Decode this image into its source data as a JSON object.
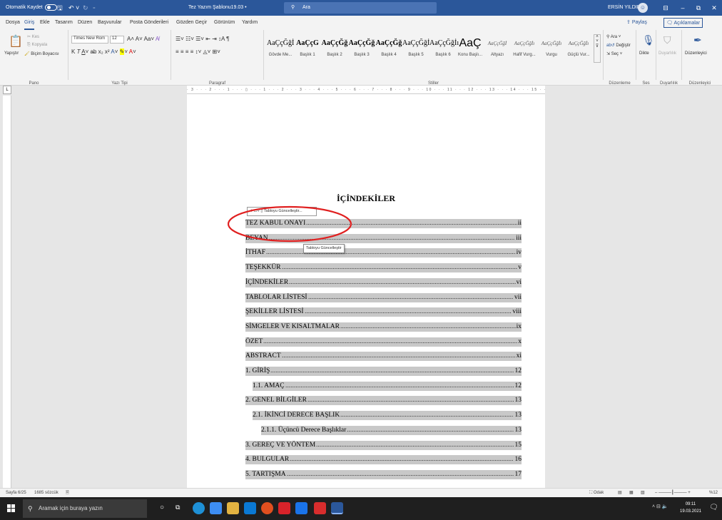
{
  "titlebar": {
    "autosave_label": "Otomatik Kaydet",
    "doc_title": "Tez Yazım Şablonu19.03 •",
    "search_placeholder": "Ara",
    "user_name": "ERSİN YILDIRIM"
  },
  "menu_tabs": [
    "Dosya",
    "Giriş",
    "Ekle",
    "Tasarım",
    "Düzen",
    "Başvurular",
    "Posta Gönderileri",
    "Gözden Geçir",
    "Görünüm",
    "Yardım"
  ],
  "share": {
    "share_label": "Paylaş",
    "comments_label": "Açıklamalar"
  },
  "ribbon": {
    "clipboard": {
      "paste": "Yapıştır",
      "cut": "Kes",
      "copy": "Kopyala",
      "format_painter": "Biçim Boyacısı",
      "group_label": "Pano"
    },
    "font": {
      "font_name": "Times New Rom",
      "font_size": "12",
      "group_label": "Yazı Tipi"
    },
    "paragraph": {
      "group_label": "Paragraf"
    },
    "styles": {
      "group_label": "Stiller",
      "items": [
        {
          "preview": "AaÇçĞğİ",
          "name": "Gövde Me..."
        },
        {
          "preview": "AaÇçG",
          "name": "Başlık 1"
        },
        {
          "preview": "AaÇçĞğ",
          "name": "Başlık 2"
        },
        {
          "preview": "AaÇçĞğ",
          "name": "Başlık 3"
        },
        {
          "preview": "AaÇçĞğ",
          "name": "Başlık 4"
        },
        {
          "preview": "AaÇçĞğİ",
          "name": "Başlık 5"
        },
        {
          "preview": "AaÇçĞğİı",
          "name": "Başlık 6"
        },
        {
          "preview": "AaÇ",
          "name": "Konu Başlı..."
        },
        {
          "preview": "AaÇçĞğİ",
          "name": "Altyazı"
        },
        {
          "preview": "AaÇçĞğİı",
          "name": "Hafif Vurg..."
        },
        {
          "preview": "AaÇçĞğİı",
          "name": "Vurgu"
        },
        {
          "preview": "AaÇçĞğİı",
          "name": "Güçlü Vur..."
        }
      ]
    },
    "editing": {
      "find": "Ara",
      "replace": "Değiştir",
      "select": "Seç",
      "group_label": "Düzenleme"
    },
    "voice": {
      "dictate": "Dikte",
      "group_label": "Ses"
    },
    "sensitivity": {
      "label": "Duyarlılık",
      "group_label": "Duyarlılık"
    },
    "editor": {
      "label": "Düzenleyici",
      "group_label": "Düzenleyici"
    }
  },
  "ruler_text": "· 3 · · · 2 · · · 1 · · · ▯ · · · 1 · · · 2 · · · 3 · · · 4 · · · 5 · · · 6 · · · 7 · · · 8 · · · 9 · · · 10 · · · 11 · · · 12 · · · 13 · · · 14 · · · 15 · · · ▯16 · · · 17 · · ·",
  "document": {
    "heading": "İÇİNDEKİLER",
    "toc_control_label": "Tabloyu Güncelleştir...",
    "tooltip": "Tabloyu Güncelleştir",
    "toc": [
      {
        "title": "TEZ KABUL ONAYI",
        "page": "ii",
        "level": 1
      },
      {
        "title": "BEYAN",
        "page": "iii",
        "level": 1
      },
      {
        "title": "İTHAF",
        "page": "iv",
        "level": 1
      },
      {
        "title": "TEŞEKKÜR",
        "page": "v",
        "level": 1
      },
      {
        "title": "İÇİNDEKİLER",
        "page": "vi",
        "level": 1
      },
      {
        "title": "TABLOLAR LİSTESİ",
        "page": "vii",
        "level": 1
      },
      {
        "title": "ŞEKİLLER LİSTESİ",
        "page": "viii",
        "level": 1
      },
      {
        "title": "SİMGELER VE KISALTMALAR",
        "page": "ix",
        "level": 1
      },
      {
        "title": "ÖZET",
        "page": "x",
        "level": 1
      },
      {
        "title": "ABSTRACT",
        "page": "xi",
        "level": 1
      },
      {
        "title": "1. GİRİŞ",
        "page": "12",
        "level": 1
      },
      {
        "title": "1.1. AMAÇ",
        "page": "12",
        "level": 2
      },
      {
        "title": "2. GENEL BİLGİLER",
        "page": "13",
        "level": 1
      },
      {
        "title": "2.1. İKİNCİ DERECE BAŞLIK",
        "page": "13",
        "level": 2
      },
      {
        "title": "2.1.1. Üçüncü Derece Başlıklar",
        "page": "13",
        "level": 3
      },
      {
        "title": "3. GEREÇ VE YÖNTEM",
        "page": "15",
        "level": 1
      },
      {
        "title": "4. BULGULAR",
        "page": "16",
        "level": 1
      },
      {
        "title": "5. TARTIŞMA",
        "page": "17",
        "level": 1
      }
    ]
  },
  "statusbar": {
    "page": "Sayfa 6/25",
    "words": "1685 sözcük",
    "focus": "Odak",
    "zoom": "%12"
  },
  "taskbar": {
    "search_placeholder": "Aramak için buraya yazın",
    "time": "09:11",
    "date": "19.03.2021"
  },
  "colors": {
    "word_blue": "#2b579a",
    "annotation_red": "#e02020",
    "field_shading": "#c8c8c8"
  }
}
